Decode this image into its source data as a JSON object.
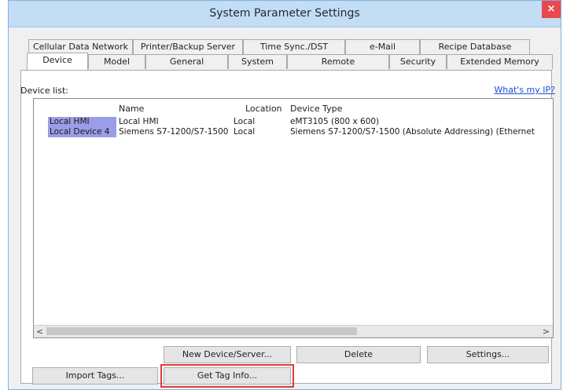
{
  "window": {
    "title": "System Parameter Settings",
    "close_glyph": "×"
  },
  "tabs_row1": [
    "Cellular Data Network",
    "Printer/Backup Server",
    "Time Sync./DST",
    "e-Mail",
    "Recipe Database"
  ],
  "tabs_row2": [
    "Device",
    "Model",
    "General",
    "System",
    "Remote",
    "Security",
    "Extended Memory"
  ],
  "active_tab": "Device",
  "device_list": {
    "label": "Device list:",
    "whats_my_ip": "What's my IP?",
    "columns": [
      "Name",
      "Location",
      "Device Type"
    ],
    "rows": [
      [
        "Local HMI",
        "Local HMI",
        "Local",
        "eMT3105 (800 x 600)"
      ],
      [
        "Local Device 4",
        "Siemens S7-1200/S7-1500",
        "Local",
        "Siemens S7-1200/S7-1500 (Absolute Addressing) (Ethernet"
      ]
    ],
    "scroll_left": "<",
    "scroll_right": ">"
  },
  "buttons": {
    "new_device": "New Device/Server...",
    "delete": "Delete",
    "settings": "Settings...",
    "import_tags": "Import Tags...",
    "get_tag_info": "Get Tag Info..."
  },
  "colors": {
    "titlebar": "#c2ddf4",
    "row_highlight": "#9a9ee8",
    "link": "#1a4fd8",
    "close": "#e8484f",
    "callout": "#e03a3a"
  }
}
